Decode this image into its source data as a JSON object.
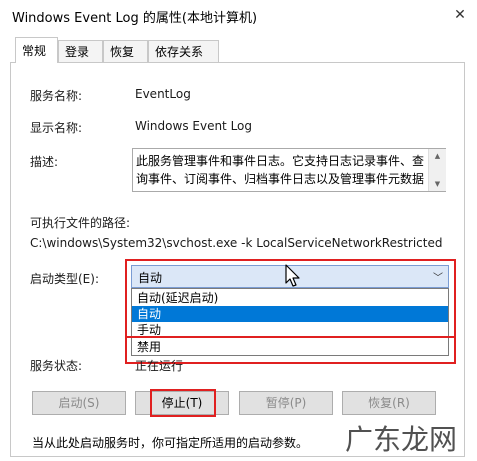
{
  "window": {
    "title": "Windows Event Log 的属性(本地计算机)",
    "close_glyph": "✕"
  },
  "tabs": [
    {
      "label": "常规"
    },
    {
      "label": "登录"
    },
    {
      "label": "恢复"
    },
    {
      "label": "依存关系"
    }
  ],
  "general": {
    "service_name_label": "服务名称:",
    "service_name_value": "EventLog",
    "display_name_label": "显示名称:",
    "display_name_value": "Windows Event Log",
    "description_label": "描述:",
    "description_text": "此服务管理事件和事件日志。它支持日志记录事件、查询事件、订阅事件、归档事件日志以及管理事件元数据",
    "path_label": "可执行文件的路径:",
    "path_value": "C:\\windows\\System32\\svchost.exe -k LocalServiceNetworkRestricted",
    "startup_type_label": "启动类型(E):",
    "startup_type_value": "自动",
    "startup_options": [
      "自动(延迟启动)",
      "自动",
      "手动",
      "禁用"
    ],
    "service_status_label": "服务状态:",
    "service_status_value": "正在运行",
    "hint": "当从此处启动服务时，你可指定所适用的启动参数。"
  },
  "buttons": {
    "start": "启动(S)",
    "stop": "停止(T)",
    "pause": "暂停(P)",
    "resume": "恢复(R)"
  },
  "watermark": "广东龙网",
  "icons": {
    "combo_arrow": "chevron-down-icon",
    "scroll_up": "scroll-up-icon",
    "scroll_down": "scroll-down-icon"
  },
  "colors": {
    "highlight": "#e02020",
    "selection": "#0078d7"
  }
}
